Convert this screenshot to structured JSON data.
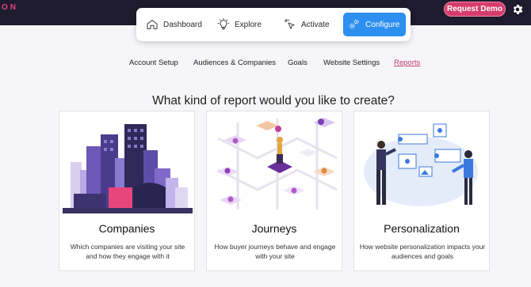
{
  "header": {
    "logo_text": "ON",
    "request_demo_label": "Request Demo"
  },
  "nav": {
    "items": [
      {
        "label": "Dashboard",
        "icon": "home-icon"
      },
      {
        "label": "Explore",
        "icon": "lightbulb-icon"
      },
      {
        "label": "Activate",
        "icon": "cursor-click-icon"
      },
      {
        "label": "Configure",
        "icon": "gears-icon",
        "active": true
      }
    ]
  },
  "subnav": {
    "items": [
      "Account Setup",
      "Audiences & Companies",
      "Goals",
      "Website Settings",
      "Reports"
    ],
    "active": "Reports"
  },
  "main": {
    "heading": "What kind of report would you like to create?",
    "cards": [
      {
        "title": "Companies",
        "description": "Which companies are visiting your site and how they engage with it"
      },
      {
        "title": "Journeys",
        "description": "How buyer journeys behave and engage with your site"
      },
      {
        "title": "Personalization",
        "description": "How website personalization impacts your audiences and goals"
      }
    ]
  },
  "colors": {
    "topbar": "#1f1b2e",
    "brand_pink": "#d63c6c",
    "configure_blue": "#2d8ff0",
    "active_link": "#c0406e"
  }
}
